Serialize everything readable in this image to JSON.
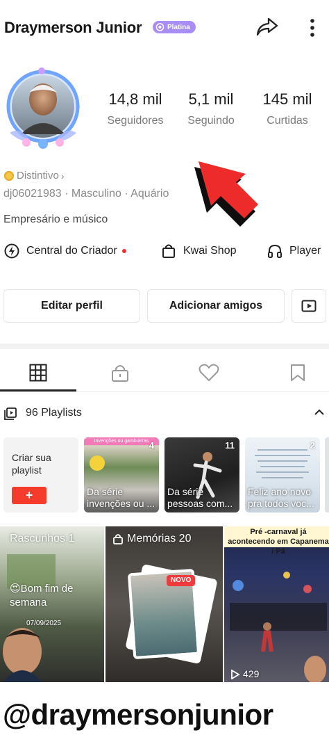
{
  "header": {
    "username": "Draymerson Junior",
    "badge": "Platina",
    "share_icon": "share-arrow-icon",
    "more_icon": "more-vertical-icon"
  },
  "profile": {
    "stats": [
      {
        "value": "14,8 mil",
        "label": "Seguidores"
      },
      {
        "value": "5,1 mil",
        "label": "Seguindo"
      },
      {
        "value": "145 mil",
        "label": "Curtidas"
      }
    ],
    "distintivo": "Distintivo",
    "info": "dj06021983 · Masculino · Aquário",
    "bio": "Empresário e músico"
  },
  "shortcuts": [
    {
      "label": "Central do Criador",
      "icon": "bolt-icon"
    },
    {
      "label": "Kwai Shop",
      "icon": "shopping-bag-icon"
    },
    {
      "label": "Player",
      "icon": "headphones-icon"
    }
  ],
  "buttons": {
    "edit": "Editar perfil",
    "add_friends": "Adicionar amigos"
  },
  "tabs": [
    {
      "name": "grid",
      "icon": "grid-icon",
      "active": true
    },
    {
      "name": "private",
      "icon": "lock-icon"
    },
    {
      "name": "liked",
      "icon": "heart-icon"
    },
    {
      "name": "saved",
      "icon": "bookmark-icon"
    }
  ],
  "playlists": {
    "title": "96 Playlists",
    "create_label": "Criar sua playlist",
    "create_button": "+",
    "items": [
      {
        "count": "4",
        "caption": "Da série invenções ou ...",
        "header": "Invenções ou gambiarras"
      },
      {
        "count": "11",
        "caption": "Da série pessoas com..."
      },
      {
        "count": "2",
        "caption": "Feliz ano novo pra todos voc..."
      }
    ]
  },
  "grid": {
    "drafts": {
      "label": "Rascunhos 1",
      "overlay": "😍Bom fim de semana",
      "date": "07/09/2025"
    },
    "memories": {
      "label": "Memórias 20",
      "new_badge": "NOVO"
    },
    "video": {
      "caption": "Pré -carnaval já acontecendo em Capanema / Pá",
      "views": "429"
    }
  },
  "footer": {
    "handle": "@draymersonjunior"
  },
  "colors": {
    "accent_red": "#f43b2c",
    "badge_purple": "#a88df5",
    "text_gray": "#8a8a8a"
  }
}
